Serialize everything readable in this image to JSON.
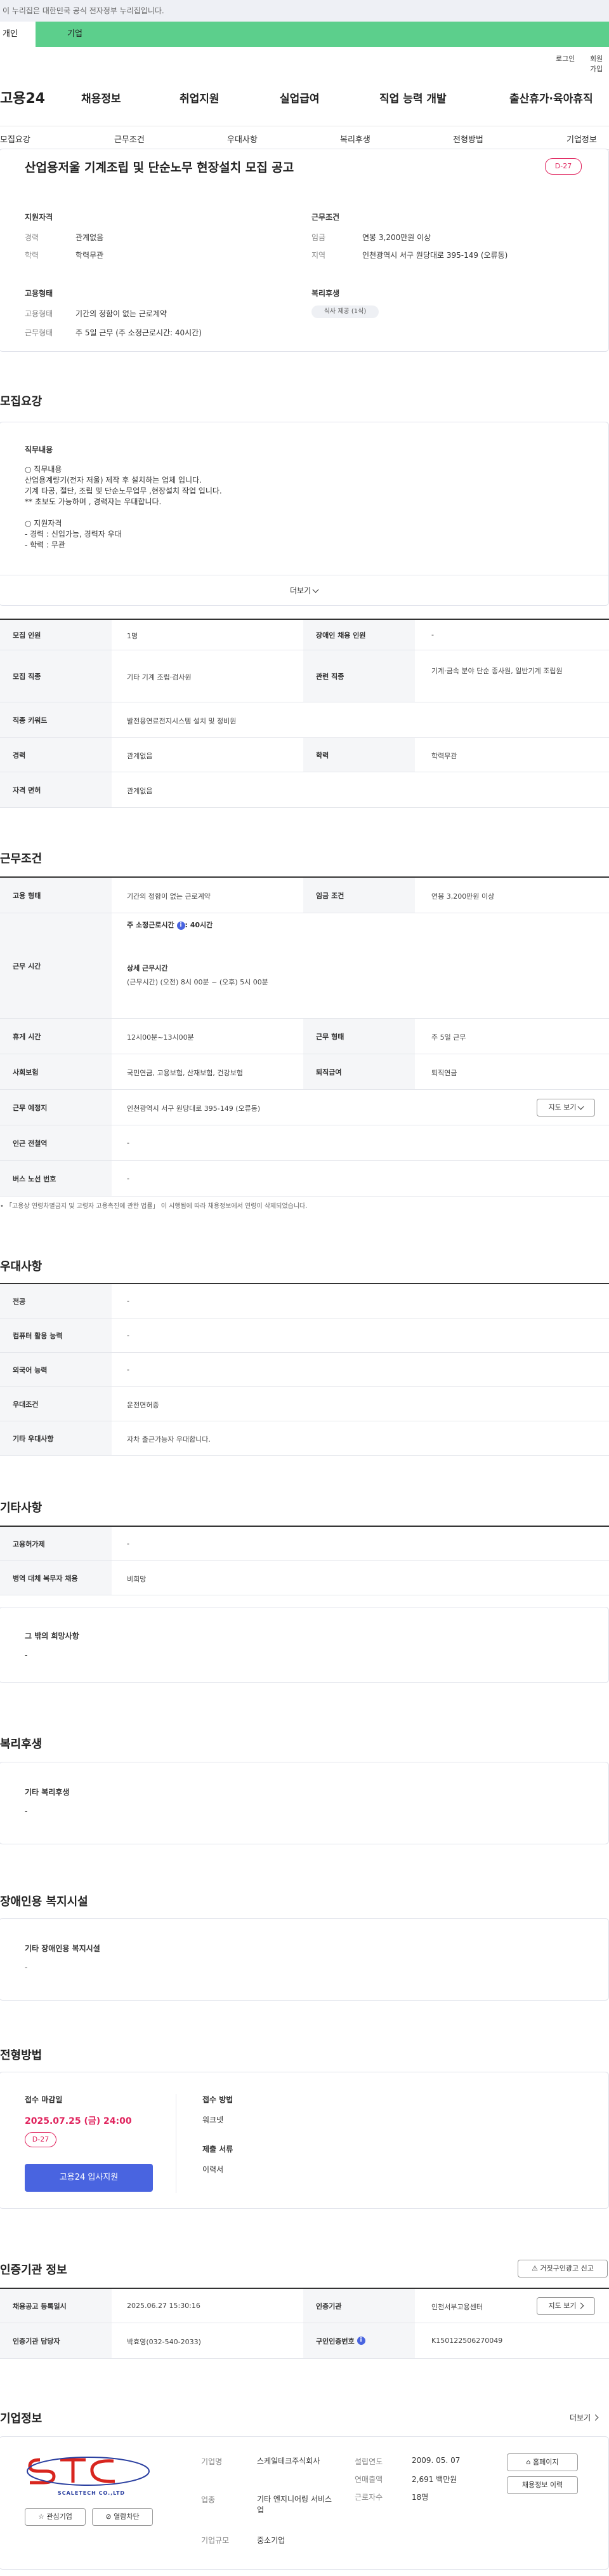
{
  "top_notice": "이 누리집은 대한민국 공식 전자정부 누리집입니다.",
  "site_tabs": [
    "개인",
    "기업"
  ],
  "util_links": [
    "로그인",
    "회원가입"
  ],
  "logo": "고용24",
  "gnb": [
    "채용정보",
    "취업지원",
    "실업급여",
    "직업 능력 개발",
    "출산휴가·육아휴직"
  ],
  "subnav": [
    "모집요강",
    "근무조건",
    "우대사항",
    "복리후생",
    "전형방법",
    "기업정보"
  ],
  "job": {
    "title": "산업용저울 기계조립 및 단순노무 현장설치 모집 공고",
    "dday": "D-27",
    "qual_title": "지원자격",
    "qual": [
      {
        "k": "경력",
        "v": "관계없음"
      },
      {
        "k": "학력",
        "v": "학력무관"
      }
    ],
    "cond_title": "근무조건",
    "cond": [
      {
        "k": "임금",
        "v": "연봉 3,200만원 이상"
      },
      {
        "k": "지역",
        "v": "인천광역시 서구 원당대로 395-149 (오류동)"
      }
    ],
    "emp_title": "고용형태",
    "emp": [
      {
        "k": "고용형태",
        "v": "기간의 정함이 없는 근로계약"
      },
      {
        "k": "근무형태",
        "v": "주 5일 근무 (주 소정근로시간: 40시간)"
      }
    ],
    "welfare_title": "복리후생",
    "welfare_chip": "식사 제공 (1식)"
  },
  "recruit": {
    "section_title": "모집요강",
    "duty_label": "직무내용",
    "duty_lines": [
      "○ 직무내용",
      "산업용계량기(전자 저울) 제작 후 설치하는 업체 입니다.",
      "기계 타공, 절단, 조립 및 단순노무업무 ,현장설치 작업 입니다.",
      "** 초보도 가능하며 , 경력자는 우대합니다.",
      "",
      "○ 지원자격",
      "- 경력 : 신입가능, 경력자 우대",
      "- 학력 : 무관"
    ],
    "more": "더보기",
    "rows": [
      {
        "k1": "모집 인원",
        "v1": "1명",
        "k2": "장애인 채용 인원",
        "v2": "-"
      },
      {
        "k1": "모집 직종",
        "v1": "기타 기계 조립·검사원",
        "k2": "관련 직종",
        "v2": "기계·금속 분야 단순 종사원, 일반기계 조립원"
      },
      {
        "k1": "직종 키워드",
        "v1": "발전용연료전지시스템 설치 및 정비원"
      },
      {
        "k1": "경력",
        "v1": "관계없음",
        "k2": "학력",
        "v2": "학력무관"
      },
      {
        "k1": "자격 면허",
        "v1": "관계없음"
      }
    ]
  },
  "workcond": {
    "section_title": "근무조건",
    "emp_type_k": "고용 형태",
    "emp_type_v": "기간의 정함이 없는 근로계약",
    "wage_k": "임금 조건",
    "wage_v": "연봉 3,200만원 이상",
    "hours_k": "근무 시간",
    "hours_weekly": "주 소정근로시간",
    "hours_weekly_v": ": 40시간",
    "hours_detail_label": "상세 근무시간",
    "hours_detail_v": "(근무시간) (오전) 8시 00분 ~ (오후) 5시 00분",
    "rest_k": "휴게 시간",
    "rest_v": "12시00분~13시00분",
    "form_k": "근무 형태",
    "form_v": "주 5일 근무",
    "ins_k": "사회보험",
    "ins_v": "국민연금, 고용보험, 산재보험, 건강보험",
    "retire_k": "퇴직급여",
    "retire_v": "퇴직연금",
    "place_k": "근무 예정지",
    "place_v": "인천광역시 서구 원당대로 395-149 (오류동)",
    "map_btn": "지도 보기",
    "subway_k": "인근 전철역",
    "subway_v": "-",
    "bus_k": "버스 노선 번호",
    "bus_v": "-",
    "footnote": "「고용상 연령차별금지 및 고령자 고용촉진에 관한 법률」 이 시행됨에 따라 채용정보에서 연령이 삭제되었습니다."
  },
  "pref": {
    "section_title": "우대사항",
    "rows": [
      {
        "k": "전공",
        "v": "-"
      },
      {
        "k": "컴퓨터 활용 능력",
        "v": "-"
      },
      {
        "k": "외국어 능력",
        "v": "-"
      },
      {
        "k": "우대조건",
        "v": "운전면허증"
      },
      {
        "k": "기타 우대사항",
        "v": "자차 출근가능자 우대합니다."
      }
    ]
  },
  "etc": {
    "section_title": "기타사항",
    "rows": [
      {
        "k": "고용허가제",
        "v": "-"
      },
      {
        "k": "병역 대체 복무자 채용",
        "v": "비희망"
      }
    ],
    "other_label": "그 밖의 희망사항",
    "other_v": "-"
  },
  "benefit": {
    "section_title": "복리후생",
    "label": "기타 복리후생",
    "v": "-"
  },
  "disability": {
    "section_title": "장애인용 복지시설",
    "label": "기타 장애인용 복지시설",
    "v": "-"
  },
  "selection": {
    "section_title": "전형방법",
    "deadline_label": "접수 마감일",
    "deadline": "2025.07.25 (금) 24:00",
    "dday": "D-27",
    "apply_btn": "고용24 입사지원",
    "method_label": "접수 방법",
    "method_v": "워크넷",
    "docs_label": "제출 서류",
    "docs_v": "이력서"
  },
  "agency": {
    "section_title": "인증기관 정보",
    "report_btn": "거짓구인광고 신고",
    "reg_date_k": "채용공고 등록일시",
    "reg_date_v": "2025.06.27 15:30:16",
    "agency_k": "인증기관",
    "agency_v": "인천서부고용센터",
    "map_btn": "지도 보기",
    "manager_k": "인증기관 담당자",
    "manager_v": "박효영(032-540-2033)",
    "cert_k": "구인인증번호",
    "cert_v": "K150122506270049"
  },
  "company": {
    "section_title": "기업정보",
    "more": "더보기",
    "logo_text": "STC",
    "logo_sub": "SCALETECH CO.,LTD",
    "fav_btn": "관심기업",
    "block_btn": "열람차단",
    "name_k": "기업명",
    "name_v": "스케일테크주식회사",
    "industry_k": "업종",
    "industry_v": "기타 엔지니어링 서비스업",
    "size_k": "기업규모",
    "size_v": "중소기업",
    "founded_k": "설립연도",
    "founded_v": "2009. 05. 07",
    "sales_k": "연매출액",
    "sales_v": "2,691 백만원",
    "staff_k": "근로자수",
    "staff_v": "18명",
    "home_btn": "홈페이지",
    "jobs_btn": "채용정보 이력",
    "colors": {
      "logo_red": "#d8261f",
      "logo_blue": "#2a3fa0"
    }
  },
  "colors": {
    "green": "#5ccf8c",
    "blue": "#4964e0",
    "pink": "#e0245e"
  }
}
